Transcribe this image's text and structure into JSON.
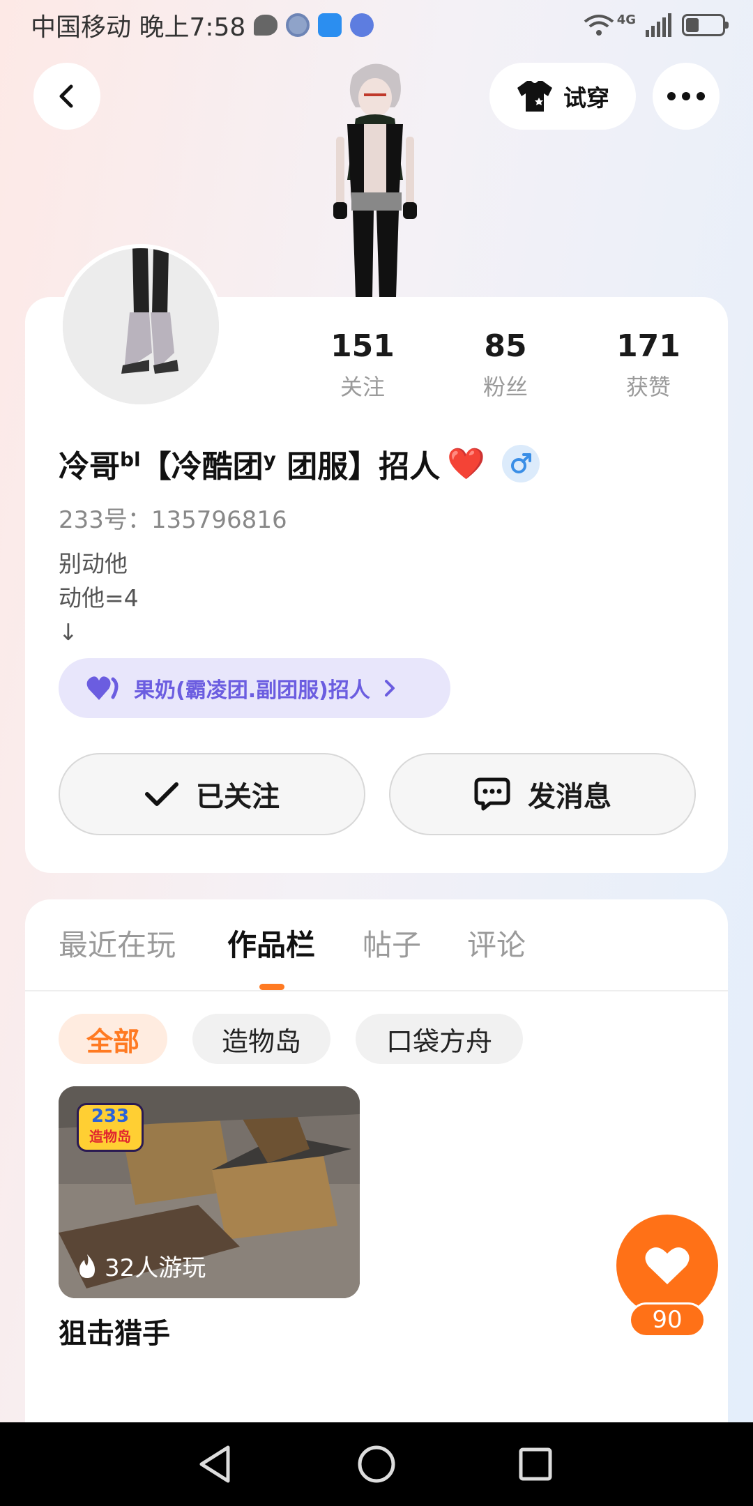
{
  "status_bar": {
    "carrier_time": "中国移动 晚上7:58",
    "network": "4G",
    "icons": [
      "chat-icon",
      "clock-icon",
      "weather-icon",
      "music-icon",
      "wifi-icon",
      "signal-icon",
      "battery-icon"
    ],
    "battery_level": 0.35
  },
  "header": {
    "back_icon": "back-arrow-icon",
    "tryon_label": "试穿",
    "tryon_icon": "tshirt-icon",
    "more_icon": "more-dots-icon"
  },
  "profile": {
    "stats": [
      {
        "value": "151",
        "label": "关注"
      },
      {
        "value": "85",
        "label": "粉丝"
      },
      {
        "value": "171",
        "label": "获赞"
      }
    ],
    "name_prefix": "冷哥",
    "name_sup1": "bl",
    "name_mid": "【冷酷团",
    "name_sup2": "y",
    "name_suffix": " 团服】招人",
    "name_emoji": "❤️",
    "gender": "male",
    "uid_text": "233号：135796816",
    "bio_lines": [
      "别动他",
      "动他=4",
      "↓"
    ],
    "group_pill_label": "果奶(霸凌团.副团服)招人",
    "follow_label": "已关注",
    "message_label": "发消息"
  },
  "works": {
    "tabs": [
      "最近在玩",
      "作品栏",
      "帖子",
      "评论"
    ],
    "active_tab": "作品栏",
    "chips": [
      "全部",
      "造物岛",
      "口袋方舟"
    ],
    "active_chip": "全部",
    "items": [
      {
        "title": "狙击猎手",
        "plays": "32人游玩",
        "badge_line1": "233",
        "badge_line2": "造物岛"
      }
    ]
  },
  "like_fab": {
    "count": "90",
    "icon": "heart-icon"
  },
  "colors": {
    "accent": "#ff7117",
    "pill_purple": "#6b5de0",
    "gender_blue": "#3a8ee6"
  }
}
